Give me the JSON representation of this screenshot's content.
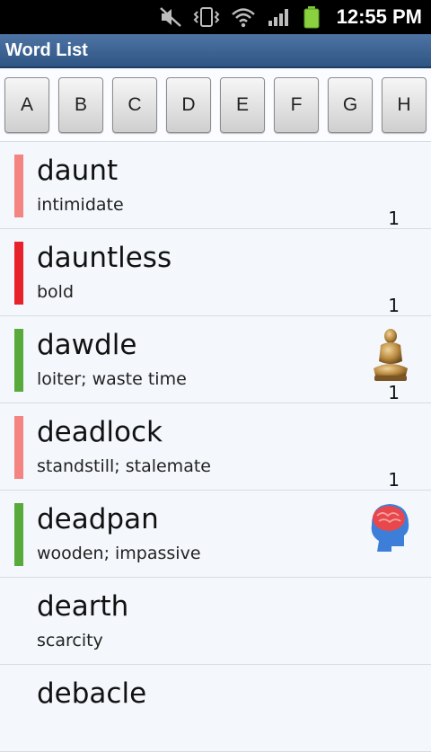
{
  "status_bar": {
    "time": "12:55 PM",
    "icons": [
      "mute-icon",
      "vibrate-icon",
      "wifi-icon",
      "signal-icon",
      "battery-icon"
    ]
  },
  "app": {
    "title": "Word List"
  },
  "letters": [
    "A",
    "B",
    "C",
    "D",
    "E",
    "F",
    "G",
    "H"
  ],
  "words": [
    {
      "word": "daunt",
      "definition": "intimidate",
      "count": "1",
      "bar_color": "#f48482",
      "icon": ""
    },
    {
      "word": "dauntless",
      "definition": "bold",
      "count": "1",
      "bar_color": "#e8222a",
      "icon": ""
    },
    {
      "word": "dawdle",
      "definition": "loiter; waste time",
      "count": "1",
      "bar_color": "#58aa3a",
      "icon": "buddha-statue-icon"
    },
    {
      "word": "deadlock",
      "definition": "standstill; stalemate",
      "count": "1",
      "bar_color": "#f48482",
      "icon": ""
    },
    {
      "word": "deadpan",
      "definition": "wooden; impassive",
      "count": "",
      "bar_color": "#58aa3a",
      "icon": "brain-head-icon"
    },
    {
      "word": "dearth",
      "definition": "scarcity",
      "count": "",
      "bar_color": "",
      "icon": ""
    },
    {
      "word": "debacle",
      "definition": "",
      "count": "",
      "bar_color": "",
      "icon": ""
    }
  ],
  "colors": {
    "title_bar": "#2f5584",
    "status_bar": "#000000",
    "list_background": "#f4f7fb"
  }
}
